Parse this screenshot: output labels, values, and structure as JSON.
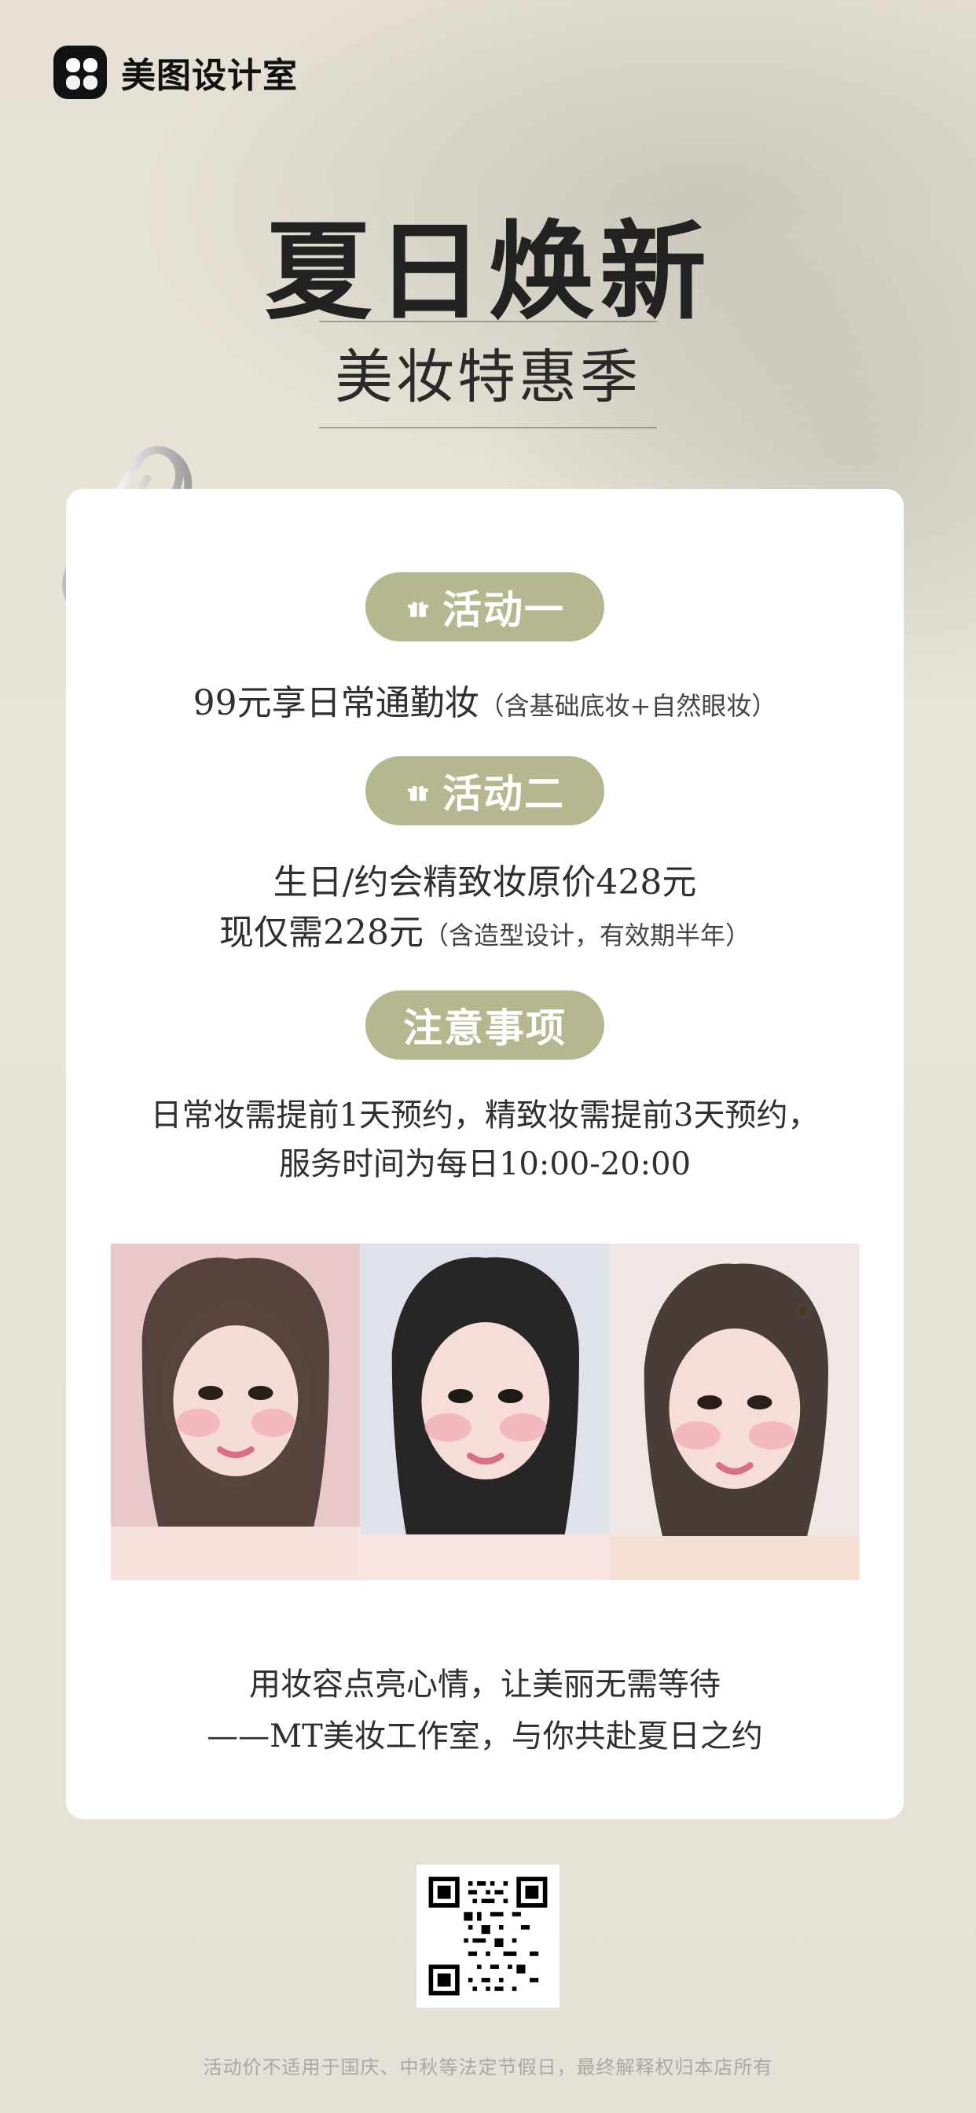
{
  "brand": {
    "name": "美图设计室",
    "logo_icon": "meitu-logo-icon"
  },
  "hero": {
    "title": "夏日焕新",
    "subtitle": "美妆特惠季"
  },
  "colors": {
    "background": "#e8e4d8",
    "accent_pill": "#b5b88e",
    "card": "#ffffff",
    "text": "#2f2f2f"
  },
  "card": {
    "sections": [
      {
        "pill": {
          "icon": "gift-icon",
          "label": "活动一"
        },
        "lines": [
          {
            "main": "99元享日常通勤妆",
            "note": "（含基础底妆+自然眼妆）"
          }
        ]
      },
      {
        "pill": {
          "icon": "gift-icon",
          "label": "活动二"
        },
        "lines": [
          {
            "main": "生日/约会精致妆原价428元",
            "note": ""
          },
          {
            "main": "现仅需228元",
            "note": "（含造型设计，有效期半年）"
          }
        ]
      },
      {
        "pill": {
          "icon": "",
          "label": "注意事项"
        },
        "lines": [
          {
            "main": "日常妆需提前1天预约，精致妆需提前3天预约，",
            "note": ""
          },
          {
            "main": "服务时间为每日10:00-20:00",
            "note": ""
          }
        ]
      }
    ],
    "quote": {
      "line1": "用妆容点亮心情，让美丽无需等待",
      "line2": "——MT美妆工作室，与你共赴夏日之约"
    }
  },
  "qr": {
    "icon": "qr-code-icon"
  },
  "footer": {
    "disclaimer": "活动价不适用于国庆、中秋等法定节假日，最终解释权归本店所有"
  }
}
